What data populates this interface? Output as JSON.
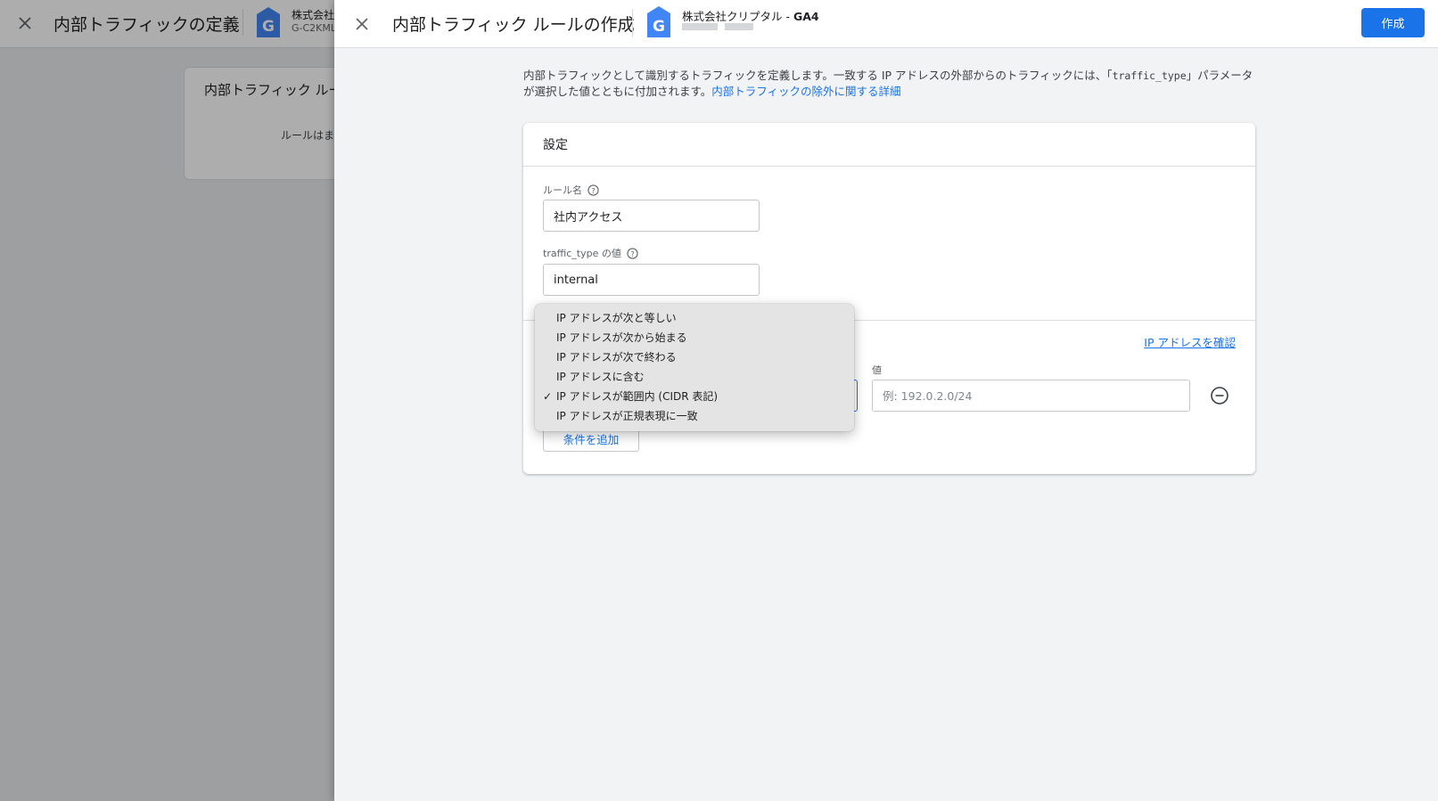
{
  "background": {
    "title": "内部トラフィックの定義",
    "property_name": "株式会社",
    "property_id": "G-C2KML",
    "card_title": "内部トラフィック ルー",
    "card_empty": "ルールはま"
  },
  "header": {
    "title": "内部トラフィック ルールの作成",
    "property_name": "株式会社クリプタル - ",
    "property_suffix": "GA4",
    "create_label": "作成"
  },
  "intro": {
    "text_before": "内部トラフィックとして識別するトラフィックを定義します。一致する IP アドレスの外部からのトラフィックには、「",
    "code": "traffic_type",
    "text_after": "」パラメータが選択した値とともに付加されます。",
    "link": "内部トラフィックの除外に関する詳細"
  },
  "settings": {
    "title": "設定",
    "rule_name_label": "ルール名",
    "rule_name_value": "社内アクセス",
    "traffic_type_label": "traffic_type の値",
    "traffic_type_value": "internal",
    "check_ip_link": "IP アドレスを確認",
    "value_label": "値",
    "value_placeholder": "例: 192.0.2.0/24",
    "add_condition_label": "条件を追加"
  },
  "menu": {
    "selected_index": 4,
    "check_glyph": "✓",
    "items": [
      "IP アドレスが次と等しい",
      "IP アドレスが次から始まる",
      "IP アドレスが次で終わる",
      "IP アドレスに含む",
      "IP アドレスが範囲内 (CIDR 表記)",
      "IP アドレスが正規表現に一致"
    ]
  },
  "colors": {
    "accent": "#1a73e8",
    "ga_logo": "#4285f4"
  }
}
